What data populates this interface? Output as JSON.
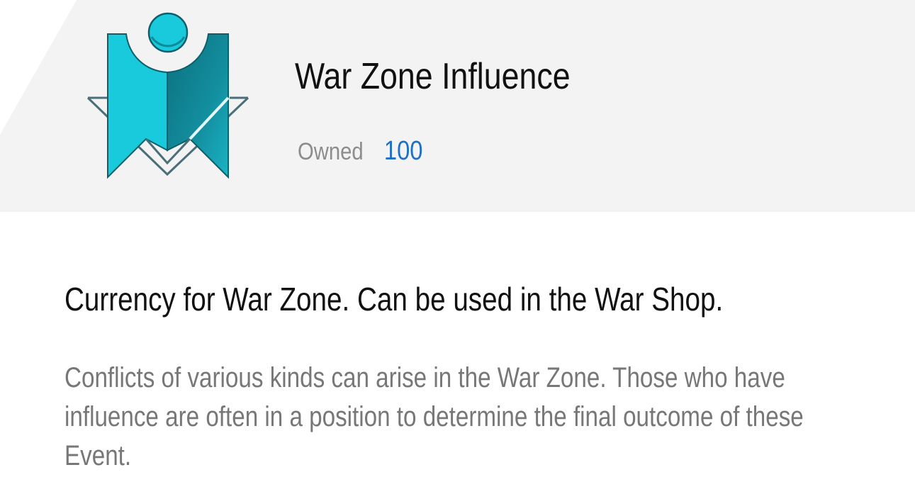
{
  "item": {
    "title": "War Zone Influence",
    "icon": "war-zone-influence-emblem",
    "owned_label": "Owned",
    "owned_value": "100",
    "summary": "Currency for War Zone. Can be used in the War Shop.",
    "description": "Conflicts of various kinds can arise in the War Zone. Those who have influence are often in a position to determine the final outcome of these Event."
  },
  "colors": {
    "header_bg": "#f3f3f3",
    "icon_cyan": "#19c9dc",
    "icon_dark": "#0f7a8a",
    "owned_value": "#1f6fc7",
    "title": "#111111",
    "description": "#777777"
  }
}
